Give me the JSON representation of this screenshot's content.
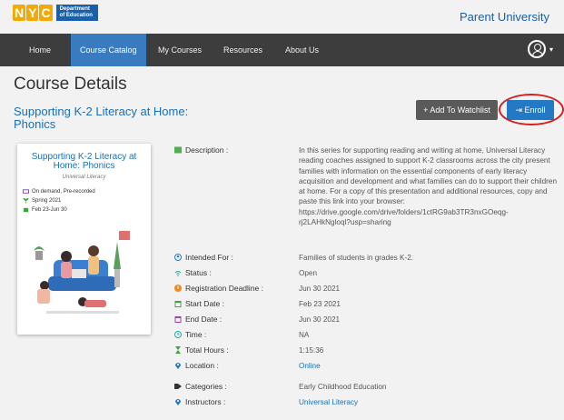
{
  "brand": {
    "logo_letters": [
      "N",
      "Y",
      "C"
    ],
    "dept_text": "Department of Education",
    "app_title": "Parent University"
  },
  "nav": {
    "items": [
      {
        "label": "Home"
      },
      {
        "label": "Course Catalog",
        "active": true
      },
      {
        "label": "My Courses"
      },
      {
        "label": "Resources"
      },
      {
        "label": "About Us"
      }
    ],
    "user_caret": "▾"
  },
  "page": {
    "heading": "Course Details",
    "course_title": "Supporting K-2 Literacy at Home: Phonics"
  },
  "actions": {
    "watchlist_label": "+ Add To Watchlist",
    "enroll_label": "⇥ Enroll"
  },
  "card": {
    "title": "Supporting K-2 Literacy at Home: Phonics",
    "provider": "Universal Literacy",
    "format": "On demand, Pre-recorded",
    "term": "Spring 2021",
    "dates": "Feb 23-Jun 30"
  },
  "details": {
    "description_label": "Description :",
    "description": "In this series for supporting reading and writing at home, Universal Literacy reading coaches assigned to support K-2 classrooms across the city present families with information on the essential components of early literacy acquisition and development and what families can do to support their children at home. For a copy of this presentation and additional resources, copy and paste this link into your browser: https://drive.google.com/drive/folders/1ctRG9ab3TR3nxGOeqg-rj2LAHkNgloql?usp=sharing",
    "intended_label": "Intended For :",
    "intended": "Families of students in grades K-2.",
    "status_label": "Status :",
    "status": "Open",
    "deadline_label": "Registration Deadline :",
    "deadline": "Jun 30 2021",
    "start_label": "Start Date :",
    "start": "Feb 23 2021",
    "end_label": "End Date :",
    "end": "Jun 30 2021",
    "time_label": "Time :",
    "time": "NA",
    "hours_label": "Total Hours :",
    "hours": "1:15:36",
    "location_label": "Location :",
    "location": "Online",
    "categories_label": "Categories :",
    "categories": "Early Childhood Education",
    "instructors_label": "Instructors :",
    "instructors": "Universal Literacy"
  },
  "colors": {
    "accent": "#2379c4",
    "nav_bg": "#3d3d3d",
    "link": "#1a6fb3",
    "highlight_ring": "#d42020"
  }
}
